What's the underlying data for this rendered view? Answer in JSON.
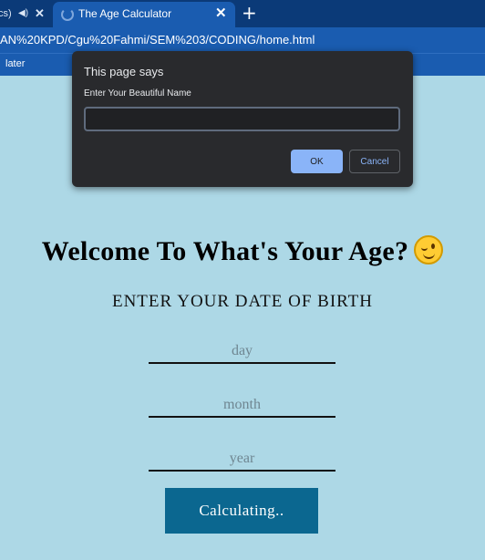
{
  "browser": {
    "prev_tab": {
      "title_fragment": "cs)",
      "mute_icon": "speaker-icon",
      "close_glyph": "✕"
    },
    "active_tab": {
      "title": "The Age Calculator",
      "close_glyph": "✕"
    },
    "new_tab_glyph": "+",
    "address": "AN%20KPD/Cgu%20Fahmi/SEM%203/CODING/home.html",
    "bookmark": "later"
  },
  "dialog": {
    "title": "This page says",
    "message": "Enter Your Beautiful Name",
    "input_value": "",
    "ok_label": "OK",
    "cancel_label": "Cancel"
  },
  "page": {
    "heading": "Welcome To What's Your Age?",
    "heading_emoji": "winking-face-icon",
    "subheading": "ENTER YOUR DATE OF BIRTH",
    "day_placeholder": "day",
    "month_placeholder": "month",
    "year_placeholder": "year",
    "button_label": "Calculating.."
  },
  "colors": {
    "page_background": "#add8e6",
    "button_background": "#0b6790",
    "chrome_blue": "#1a5cb0",
    "dialog_background": "#292a2d",
    "dialog_ok": "#8ab4f8"
  }
}
